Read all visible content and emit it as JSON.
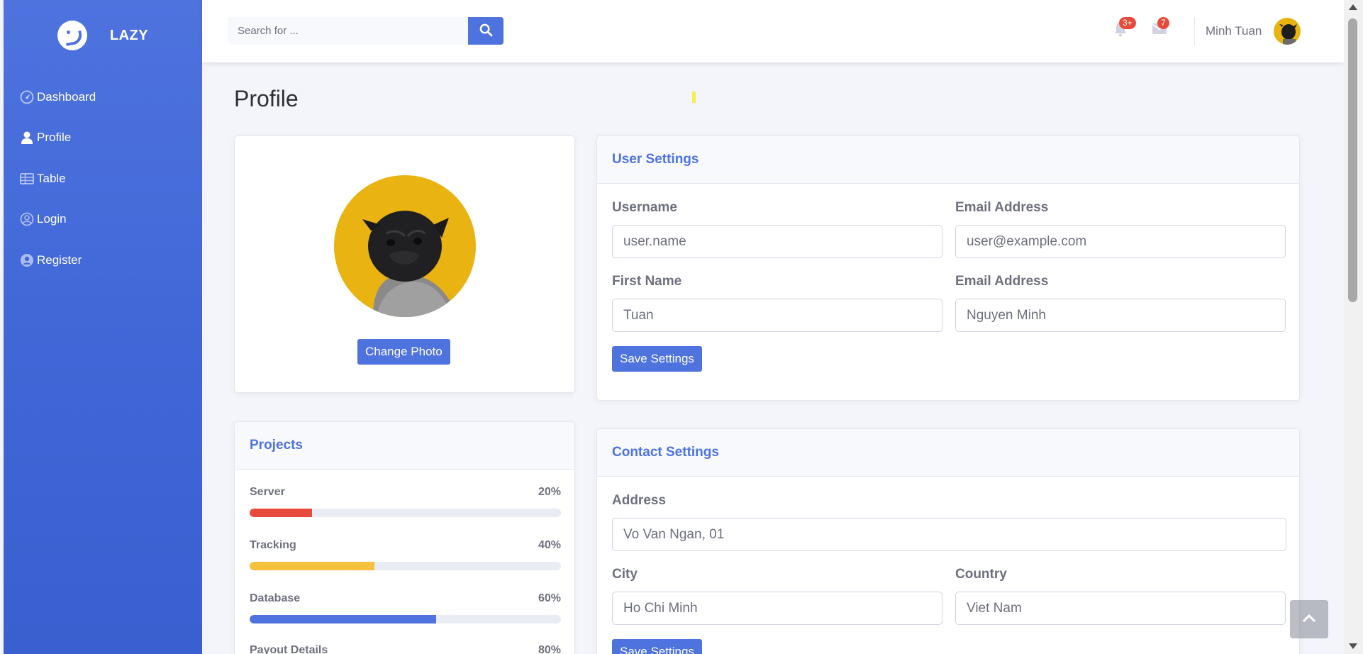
{
  "brand": {
    "name": "LAZY",
    "icon": "laugh-wink-icon"
  },
  "sidebar": {
    "items": [
      {
        "label": "Dashboard",
        "icon": "dashboard-icon"
      },
      {
        "label": "Profile",
        "icon": "user-icon"
      },
      {
        "label": "Table",
        "icon": "table-icon"
      },
      {
        "label": "Login",
        "icon": "user-circle-icon"
      },
      {
        "label": "Register",
        "icon": "user-circle-solid-icon"
      }
    ]
  },
  "topbar": {
    "search_placeholder": "Search for ...",
    "alerts_badge": "3+",
    "messages_badge": "7",
    "user_name": "Minh Tuan"
  },
  "page": {
    "title": "Profile"
  },
  "photo_card": {
    "change_photo_label": "Change Photo"
  },
  "projects": {
    "title": "Projects",
    "items": [
      {
        "name": "Server",
        "percent_label": "20%",
        "percent": 20,
        "color": "#e74a3b"
      },
      {
        "name": "Tracking",
        "percent_label": "40%",
        "percent": 40,
        "color": "#f6c23e"
      },
      {
        "name": "Database",
        "percent_label": "60%",
        "percent": 60,
        "color": "#4e73df"
      },
      {
        "name": "Payout Details",
        "percent_label": "80%",
        "percent": 80,
        "color": "#36b9cc"
      }
    ]
  },
  "user_settings": {
    "title": "User Settings",
    "username_label": "Username",
    "username_value": "user.name",
    "email_label": "Email Address",
    "email_value": "user@example.com",
    "first_name_label": "First Name",
    "first_name_value": "Tuan",
    "last_name_label": "Email Address",
    "last_name_value": "Nguyen Minh",
    "save_label": "Save Settings"
  },
  "contact_settings": {
    "title": "Contact Settings",
    "address_label": "Address",
    "address_value": "Vo Van Ngan, 01",
    "city_label": "City",
    "city_value": "Ho Chi Minh",
    "country_label": "Country",
    "country_value": "Viet Nam",
    "save_label": "Save Settings"
  },
  "colors": {
    "primary": "#4e73df",
    "danger": "#e74a3b",
    "warning": "#f6c23e"
  }
}
